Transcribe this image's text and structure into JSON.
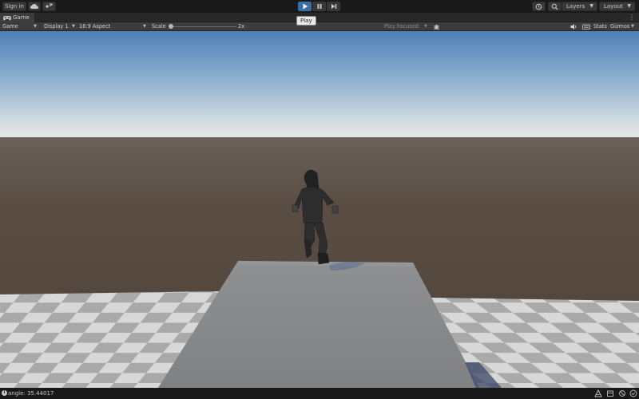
{
  "toolbar": {
    "sign_in_label": "Sign in",
    "cloud_icon": "cloud-icon",
    "collab_icon": "collab-icon",
    "play_icon": "play-icon",
    "pause_icon": "pause-icon",
    "step_icon": "step-icon",
    "history_icon": "history-icon",
    "search_icon": "search-icon",
    "layers_label": "Layers",
    "layout_label": "Layout",
    "accent_color": "#3a6ea5"
  },
  "tooltip": {
    "text": "Play"
  },
  "tab": {
    "icon": "game-controller-icon",
    "label": "Game"
  },
  "gamebar": {
    "mode_label": "Game",
    "display_label": "Display 1",
    "aspect_label": "16:9 Aspect",
    "scale_label": "Scale",
    "scale_value": "2x",
    "scale_fraction": 0.0,
    "play_focused_label": "Play Focused",
    "stats_label": "Stats",
    "gizmos_label": "Gizmos"
  },
  "status": {
    "text": "angle: 35.44017"
  }
}
